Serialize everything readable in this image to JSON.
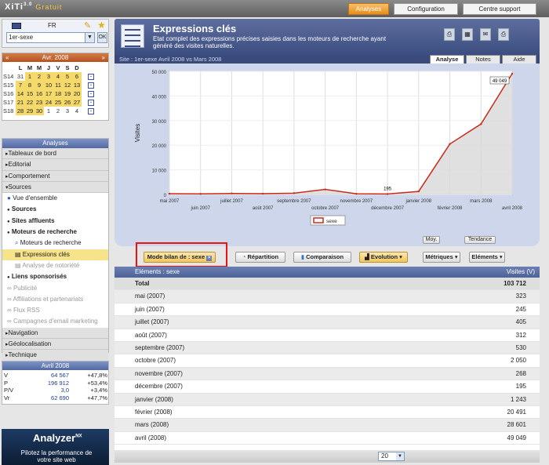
{
  "app": {
    "logo": "XiTi",
    "logo_sup": "3.0",
    "edition": "Gratuit"
  },
  "topnav": [
    {
      "label": "Analyses",
      "active": true
    },
    {
      "label": "Configuration"
    },
    {
      "label": "Centre support"
    }
  ],
  "site": {
    "lang": "FR",
    "selected": "1er-sexe",
    "ok": "OK"
  },
  "calendar": {
    "month": "Avr. 2008",
    "prev": "«",
    "next": "»",
    "weekdays": [
      "L",
      "M",
      "M",
      "J",
      "V",
      "S",
      "D"
    ],
    "weeks": [
      {
        "wk": "S14",
        "days": [
          "31",
          "1",
          "2",
          "3",
          "4",
          "5",
          "6"
        ]
      },
      {
        "wk": "S15",
        "days": [
          "7",
          "8",
          "9",
          "10",
          "11",
          "12",
          "13"
        ]
      },
      {
        "wk": "S16",
        "days": [
          "14",
          "15",
          "16",
          "17",
          "18",
          "19",
          "20"
        ]
      },
      {
        "wk": "S17",
        "days": [
          "21",
          "22",
          "23",
          "24",
          "25",
          "26",
          "27"
        ]
      },
      {
        "wk": "S18",
        "days": [
          "28",
          "29",
          "30",
          "1",
          "2",
          "3",
          "4"
        ]
      }
    ]
  },
  "sidebar": {
    "header": "Analyses",
    "items": [
      {
        "label": "Tableaux de bord",
        "type": "grp"
      },
      {
        "label": "Editorial",
        "type": "grp"
      },
      {
        "label": "Comportement",
        "type": "grp"
      },
      {
        "label": "Sources",
        "type": "open"
      },
      {
        "label": "Vue d'ensemble",
        "type": "sub"
      },
      {
        "label": "Sources",
        "type": "subb"
      },
      {
        "label": "Sites affluents",
        "type": "subb"
      },
      {
        "label": "Moteurs de recherche",
        "type": "subb"
      },
      {
        "label": "Moteurs de recherche",
        "type": "sub2"
      },
      {
        "label": "Expressions clés",
        "type": "sel"
      },
      {
        "label": "Analyse de notoriété",
        "type": "dim"
      },
      {
        "label": "Liens sponsorisés",
        "type": "subb"
      },
      {
        "label": "Publicité",
        "type": "dim1"
      },
      {
        "label": "Affiliations et partenariats",
        "type": "dim1"
      },
      {
        "label": "Flux RSS",
        "type": "dim1"
      },
      {
        "label": "Campagnes d'email marketing",
        "type": "dim1"
      },
      {
        "label": "Navigation",
        "type": "grp"
      },
      {
        "label": "Géolocalisation",
        "type": "grp"
      },
      {
        "label": "Technique",
        "type": "grp"
      }
    ]
  },
  "stats": {
    "header": "Avril 2008",
    "rows": [
      {
        "k": "V",
        "v": "64 567",
        "p": "+47,8%"
      },
      {
        "k": "P",
        "v": "196 912",
        "p": "+53,4%"
      },
      {
        "k": "P/V",
        "v": "3,0",
        "p": "+3,4%"
      },
      {
        "k": "Vr",
        "v": "62 690",
        "p": "+47,7%"
      }
    ]
  },
  "ad": {
    "title": "Analyzer",
    "sup": "NX",
    "line1": "Pilotez la performance de",
    "line2": "votre site web"
  },
  "page": {
    "title": "Expressions clés",
    "description": "Etat complet des expressions précises saisies dans les moteurs de recherche ayant généré des visites naturelles.",
    "subbar": "Site : 1er-sexe      Avril 2008 vs Mars 2008",
    "tabs": [
      "Analyse",
      "Notes",
      "Aide"
    ]
  },
  "chart_data": {
    "type": "line",
    "ylabel": "Visites",
    "ylim": [
      0,
      50000
    ],
    "yticks": [
      "0",
      "10 000",
      "20 000",
      "30 000",
      "40 000",
      "50 000"
    ],
    "x": [
      "mai 2007",
      "juin 2007",
      "juillet 2007",
      "août 2007",
      "septembre 2007",
      "octobre 2007",
      "novembre 2007",
      "décembre 2007",
      "janvier 2008",
      "février 2008",
      "mars 2008",
      "avril 2008"
    ],
    "series": [
      {
        "name": "sexe",
        "values": [
          323,
          245,
          405,
          312,
          530,
          2050,
          268,
          195,
          1243,
          20491,
          28601,
          49049
        ],
        "color": "#cc2a1a"
      }
    ],
    "annotations": [
      {
        "index": 7,
        "label": "195"
      },
      {
        "index": 11,
        "label": "49 049"
      }
    ],
    "legend": "bottom"
  },
  "controls": {
    "mode": "Mode bilan de : sexe",
    "repartition": "Répartition",
    "comparaison": "Comparaison",
    "evolution": "Evolution",
    "metriques": "Métriques",
    "elements": "Eléments",
    "moy": "Moy.",
    "tendance": "Tendance"
  },
  "table": {
    "col1": "Eléments : sexe",
    "col2": "Visites (V)",
    "total": {
      "label": "Total",
      "value": "103 712"
    },
    "rows": [
      {
        "label": "mai (2007)",
        "value": "323"
      },
      {
        "label": "juin (2007)",
        "value": "245"
      },
      {
        "label": "juillet (2007)",
        "value": "405"
      },
      {
        "label": "août (2007)",
        "value": "312"
      },
      {
        "label": "septembre (2007)",
        "value": "530"
      },
      {
        "label": "octobre (2007)",
        "value": "2 050"
      },
      {
        "label": "novembre (2007)",
        "value": "268"
      },
      {
        "label": "décembre (2007)",
        "value": "195"
      },
      {
        "label": "janvier (2008)",
        "value": "1 243"
      },
      {
        "label": "février (2008)",
        "value": "20 491"
      },
      {
        "label": "mars (2008)",
        "value": "28 601"
      },
      {
        "label": "avril (2008)",
        "value": "49 049"
      }
    ],
    "pagesize": "20"
  }
}
